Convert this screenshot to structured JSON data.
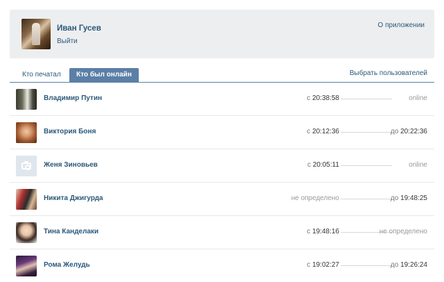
{
  "header": {
    "user_name": "Иван Гусев",
    "logout_label": "Выйти",
    "about_link": "О приложении"
  },
  "tabs": [
    {
      "label": "Кто печатал",
      "active": false
    },
    {
      "label": "Кто был онлайн",
      "active": true
    }
  ],
  "choose_users_link": "Выбрать пользователей",
  "rows": [
    {
      "name": "Владимир Путин",
      "from_prefix": "с",
      "from_time": "20:38:58",
      "to_prefix": "",
      "to_time": "online"
    },
    {
      "name": "Виктория Боня",
      "from_prefix": "с",
      "from_time": "20:12:36",
      "to_prefix": "до",
      "to_time": "20:22:36"
    },
    {
      "name": "Женя Зиновьев",
      "from_prefix": "с",
      "from_time": "20:05:11",
      "to_prefix": "",
      "to_time": "online"
    },
    {
      "name": "Никита Джигурда",
      "from_prefix": "",
      "from_time": "не определено",
      "to_prefix": "до",
      "to_time": "19:48:25"
    },
    {
      "name": "Тина Канделаки",
      "from_prefix": "с",
      "from_time": "19:48:16",
      "to_prefix": "",
      "to_time": "не определено"
    },
    {
      "name": "Рома Желудь",
      "from_prefix": "с",
      "from_time": "19:02:27",
      "to_prefix": "до",
      "to_time": "19:26:24"
    }
  ],
  "colors": {
    "link": "#2b587a",
    "tab_active_bg": "#5b7fa6",
    "header_bg": "#edeef0"
  }
}
